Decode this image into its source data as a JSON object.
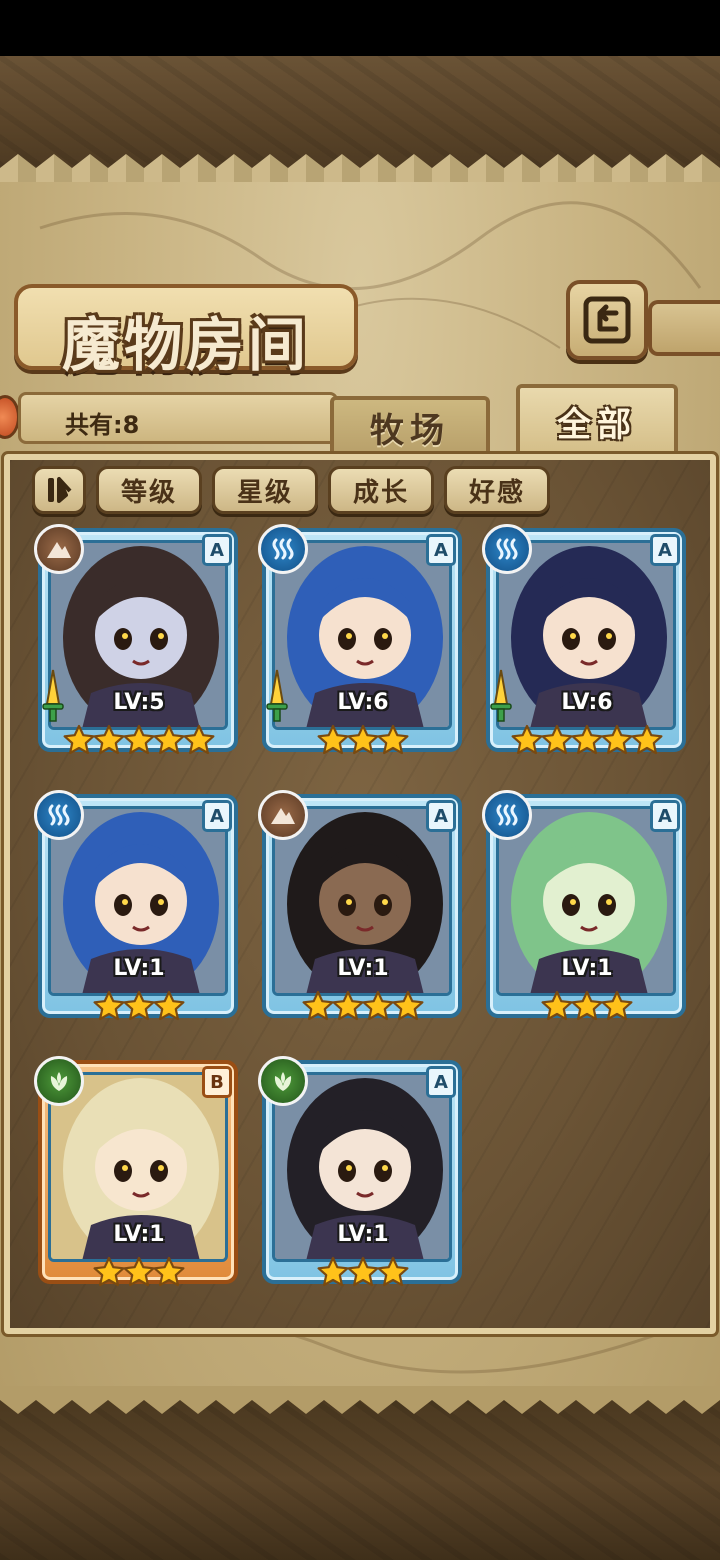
{
  "header": {
    "title": "魔物房间"
  },
  "count": {
    "label": "共有:8"
  },
  "tabs": [
    {
      "label": "牧场",
      "active": false
    },
    {
      "label": "全部",
      "active": true
    }
  ],
  "filters": [
    {
      "label": "等级"
    },
    {
      "label": "星级"
    },
    {
      "label": "成长"
    },
    {
      "label": "好感"
    }
  ],
  "monsters": [
    {
      "element": "earth-icon",
      "rank": "A",
      "level": "LV:5",
      "stars": 5,
      "weapon": true,
      "hair": "#3a2c2a",
      "skin": "#cfd2e6"
    },
    {
      "element": "water-icon",
      "rank": "A",
      "level": "LV:6",
      "stars": 3,
      "weapon": true,
      "hair": "#2f5fb8",
      "skin": "#f6e1cf"
    },
    {
      "element": "water-icon",
      "rank": "A",
      "level": "LV:6",
      "stars": 5,
      "weapon": true,
      "hair": "#252a55",
      "skin": "#f6e1cf"
    },
    {
      "element": "water-icon",
      "rank": "A",
      "level": "LV:1",
      "stars": 3,
      "weapon": false,
      "hair": "#2f5fb8",
      "skin": "#f6e1cf"
    },
    {
      "element": "earth-icon",
      "rank": "A",
      "level": "LV:1",
      "stars": 4,
      "weapon": false,
      "hair": "#1f1a1a",
      "skin": "#8a6a52"
    },
    {
      "element": "water-icon",
      "rank": "A",
      "level": "LV:1",
      "stars": 3,
      "weapon": false,
      "hair": "#7fc48a",
      "skin": "#e2f0d0"
    },
    {
      "element": "wood-icon",
      "rank": "B",
      "level": "LV:1",
      "stars": 3,
      "weapon": false,
      "hair": "#e9dfb6",
      "skin": "#f7e6cf"
    },
    {
      "element": "wood-icon",
      "rank": "A",
      "level": "LV:1",
      "stars": 3,
      "weapon": false,
      "hair": "#232027",
      "skin": "#f4e4d6"
    }
  ],
  "colors": {
    "star": "#ffc21a",
    "frame_a": "#2b6f96",
    "frame_b": "#9a4e14"
  }
}
